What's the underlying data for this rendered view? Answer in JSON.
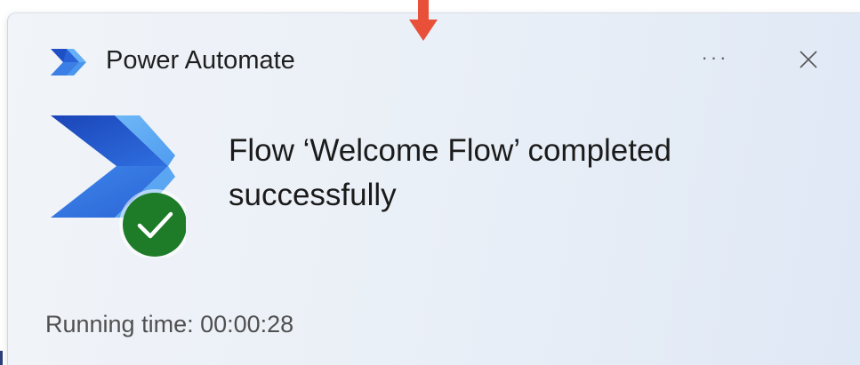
{
  "notification": {
    "app_name": "Power Automate",
    "message": "Flow ‘Welcome Flow’ completed successfully",
    "running_time": "Running time: 00:00:28"
  },
  "controls": {
    "more_label": "···"
  },
  "icons": {
    "app_logo": "power-automate-logo",
    "status": "success-check-icon",
    "pointer": "red-arrow-pointer"
  },
  "colors": {
    "brand_dark_blue": "#1e4fc4",
    "brand_light_blue": "#5aa6f2",
    "success_green": "#1e7b28",
    "annotation_red": "#e8503a"
  }
}
